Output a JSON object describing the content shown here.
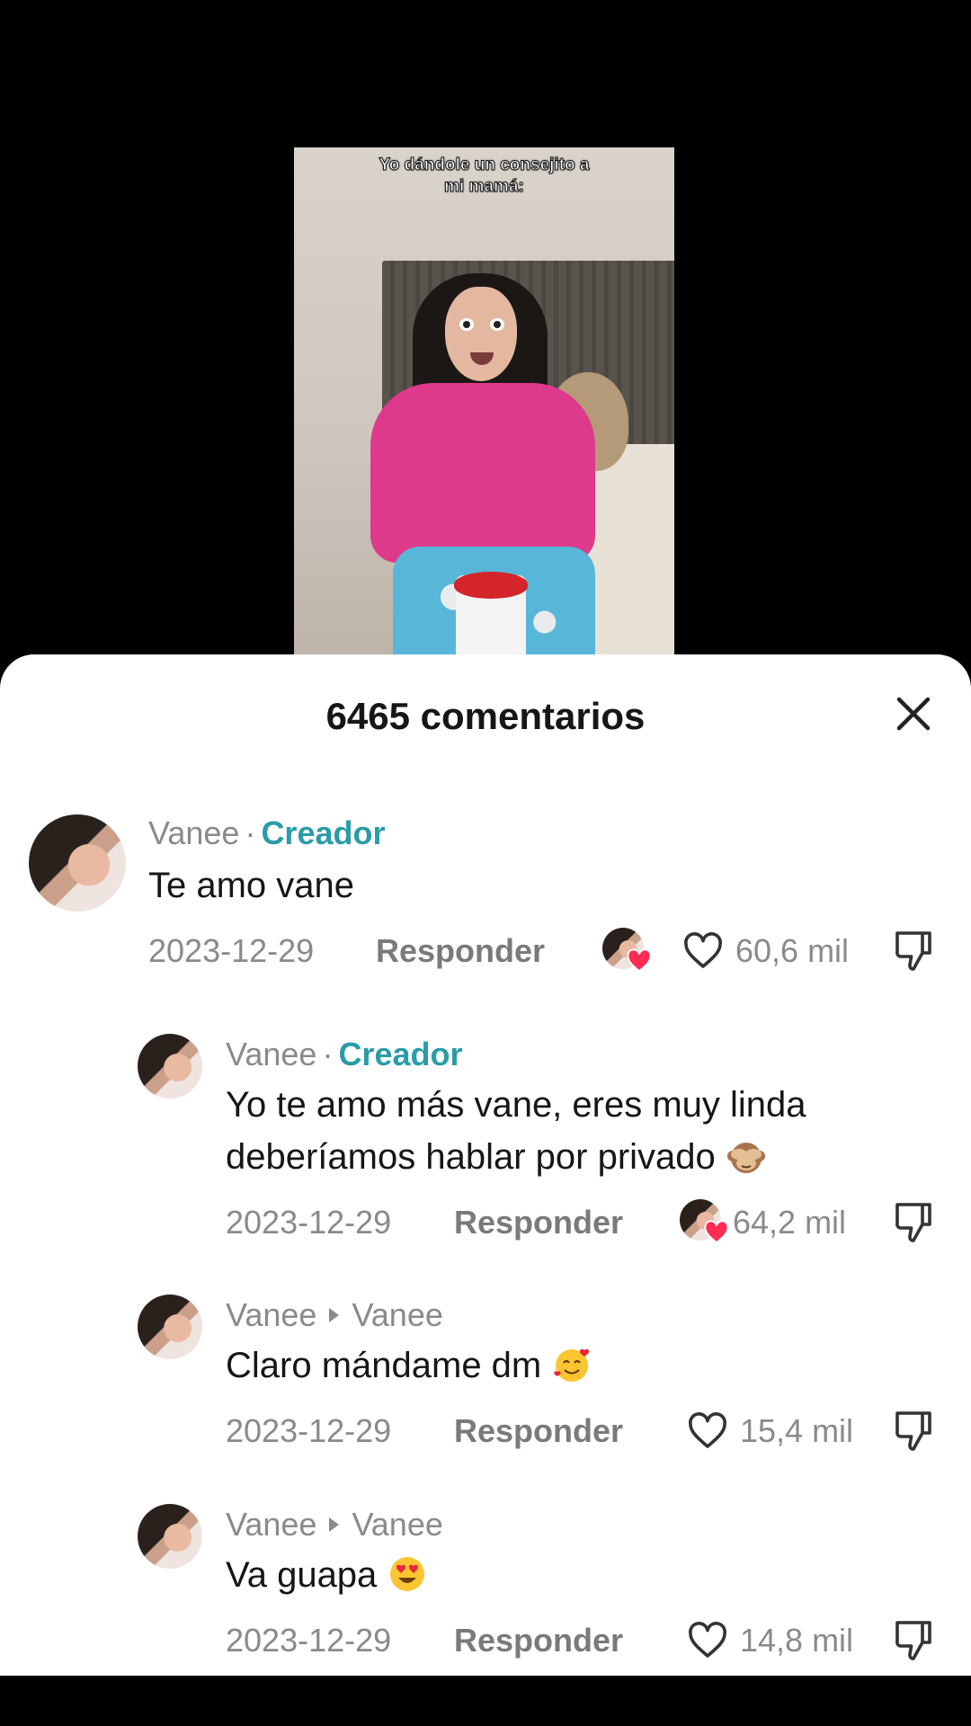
{
  "video": {
    "caption_line1": "Yo dándole un consejito a",
    "caption_line2": "mi mamá:"
  },
  "comments_sheet": {
    "title": "6465 comentarios",
    "close_icon": "close-icon"
  },
  "comments": [
    {
      "author": "Vanee",
      "badge": "Creador",
      "text": "Te amo vane",
      "date": "2023-12-29",
      "reply_label": "Responder",
      "likes": "60,6 mil",
      "liked_by_creator": true
    },
    {
      "author": "Vanee",
      "badge": "Creador",
      "text_line1": "Yo te amo más vane, eres muy linda",
      "text_line2": "deberíamos hablar por privado",
      "emoji": "see-no-evil-monkey",
      "date": "2023-12-29",
      "reply_label": "Responder",
      "likes": "64,2 mil",
      "liked_by_creator": true
    },
    {
      "author": "Vanee",
      "reply_to": "Vanee",
      "text": "Claro mándame dm",
      "emoji": "smiling-face-with-hearts",
      "date": "2023-12-29",
      "reply_label": "Responder",
      "likes": "15,4 mil",
      "liked_by_creator": false
    },
    {
      "author": "Vanee",
      "reply_to": "Vanee",
      "text": "Va guapa",
      "emoji": "heart-eyes",
      "date": "2023-12-29",
      "reply_label": "Responder",
      "likes": "14,8 mil",
      "liked_by_creator": false
    }
  ],
  "colors": {
    "creator_badge": "#2a9ca8",
    "secondary_text": "#8a8a8a",
    "primary_text": "#161616",
    "heart_red": "#fe2c55"
  }
}
